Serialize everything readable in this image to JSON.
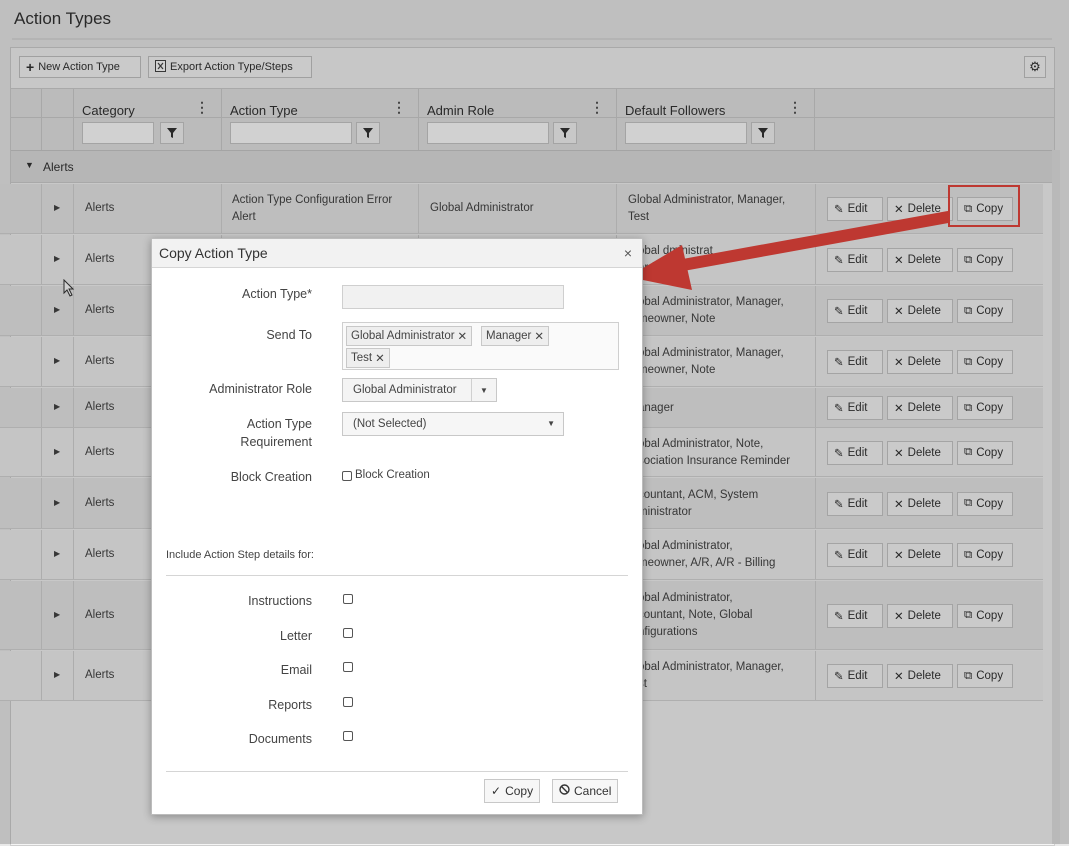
{
  "page": {
    "title": "Action Types"
  },
  "toolbar": {
    "new_label": "New Action Type",
    "export_label": "Export Action Type/Steps"
  },
  "columns": {
    "category": "Category",
    "action_type": "Action Type",
    "admin_role": "Admin Role",
    "default_followers": "Default Followers"
  },
  "group": {
    "label": "Alerts"
  },
  "rows": [
    {
      "category": "Alerts",
      "action_type_1": "Action Type Configuration Error",
      "action_type_2": "Alert",
      "admin_role": "Global Administrator",
      "followers_1": "Global Administrator, Manager,",
      "followers_2": "Test"
    },
    {
      "category": "Alerts",
      "followers_1": "obal  dministrat",
      "followers_2": "ard"
    },
    {
      "category": "Alerts",
      "followers_1": "obal Administrator, Manager,",
      "followers_2": "meowner, Note"
    },
    {
      "category": "Alerts",
      "followers_1": "obal Administrator, Manager,",
      "followers_2": "meowner, Note"
    },
    {
      "category": "Alerts",
      "followers_1": "anager",
      "followers_2": ""
    },
    {
      "category": "Alerts",
      "followers_1": "obal Administrator, Note,",
      "followers_2": "sociation Insurance Reminder"
    },
    {
      "category": "Alerts",
      "followers_1": "countant, ACM, System",
      "followers_2": "ministrator"
    },
    {
      "category": "Alerts",
      "followers_1": "obal Administrator,",
      "followers_2": "meowner, A/R, A/R - Billing"
    },
    {
      "category": "Alerts",
      "followers_1": "obal Administrator,",
      "followers_2": "countant, Note, Global",
      "followers_3": "nfigurations"
    },
    {
      "category": "Alerts",
      "followers_1": "obal Administrator, Manager,",
      "followers_2": "st"
    }
  ],
  "row_actions": {
    "edit": "Edit",
    "delete": "Delete",
    "copy": "Copy"
  },
  "modal": {
    "title": "Copy Action Type",
    "action_type_label": "Action Type*",
    "send_to_label": "Send To",
    "send_to_tags": [
      "Global Administrator",
      "Manager",
      "Test"
    ],
    "admin_role_label": "Administrator Role",
    "admin_role_value": "Global Administrator",
    "requirement_label_1": "Action Type",
    "requirement_label_2": "Requirement",
    "requirement_value": "(Not Selected)",
    "block_creation_label": "Block Creation",
    "block_creation_check_label": "Block Creation",
    "include_heading": "Include Action Step details for:",
    "include_items": [
      "Instructions",
      "Letter",
      "Email",
      "Reports",
      "Documents"
    ],
    "copy_button": "Copy",
    "cancel_button": "Cancel"
  },
  "colors": {
    "accent_red": "#e8453c"
  }
}
